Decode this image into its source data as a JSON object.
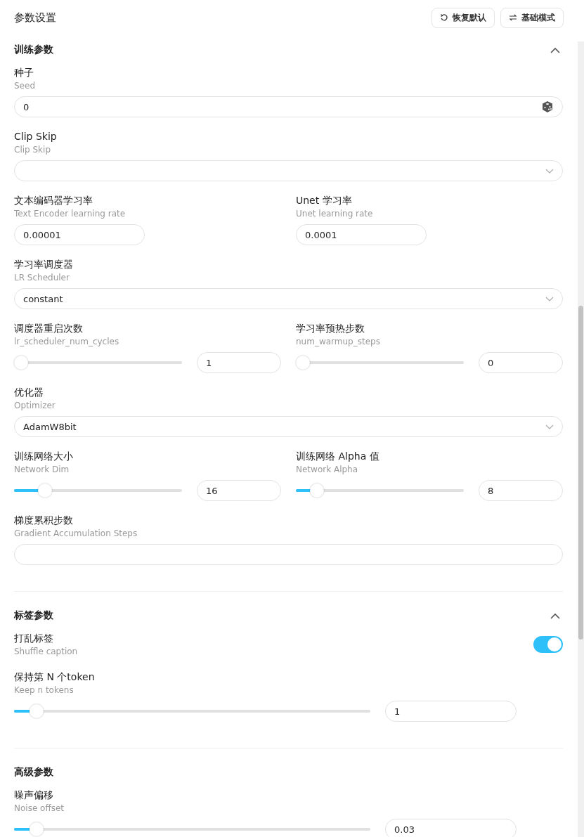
{
  "title": "参数设置",
  "buttons": [
    {
      "label": "恢复默认",
      "kind": "reset"
    },
    {
      "label": "基础模式",
      "kind": "swap"
    }
  ],
  "sections": [
    {
      "title": "训练参数",
      "expanded": true,
      "rows": [
        {
          "fields": [
            {
              "kind": "seed",
              "label": "种子",
              "sublabel": "Seed",
              "value": "0"
            }
          ]
        },
        {
          "fields": [
            {
              "kind": "select",
              "label": "Clip Skip",
              "sublabel": "Clip Skip"
            }
          ]
        },
        {
          "fields": [
            {
              "kind": "number",
              "label": "文本编码器学习率",
              "sublabel": "Text Encoder learning rate",
              "value": "0.00001"
            },
            {
              "kind": "number",
              "label": "Unet 学习率",
              "sublabel": "Unet learning rate",
              "value": "0.0001"
            }
          ]
        },
        {
          "fields": [
            {
              "kind": "select",
              "label": "学习率调度器",
              "sublabel": "LR Scheduler",
              "value": "constant"
            }
          ]
        },
        {
          "fields": [
            {
              "kind": "slider",
              "label": "调度器重启次数",
              "sublabel": "lr_scheduler_num_cycles",
              "value": "1",
              "level": 0
            },
            {
              "kind": "slider",
              "label": "学习率预热步数",
              "sublabel": "num_warmup_steps",
              "value": "0",
              "level": 0
            }
          ]
        },
        {
          "fields": [
            {
              "kind": "select",
              "label": "优化器",
              "sublabel": "Optimizer",
              "value": "AdamW8bit"
            }
          ]
        },
        {
          "fields": [
            {
              "kind": "slider",
              "label": "训练网络大小",
              "sublabel": "Network Dim",
              "value": "16",
              "level": 0.155
            },
            {
              "kind": "slider",
              "label": "训练网络 Alpha 值",
              "sublabel": "Network Alpha",
              "value": "8",
              "level": 0.09
            }
          ]
        },
        {
          "fields": [
            {
              "kind": "text",
              "label": "梯度累积步数",
              "sublabel": "Gradient Accumulation Steps"
            }
          ]
        }
      ]
    },
    {
      "title": "标签参数",
      "expanded": true,
      "rows": [
        {
          "fields": [
            {
              "kind": "switch",
              "label": "打乱标签",
              "sublabel": "Shuffle caption",
              "on": true
            }
          ]
        },
        {
          "fields": [
            {
              "kind": "slider",
              "label": "保持第 N 个token",
              "sublabel": "Keep n tokens",
              "value": "1",
              "level": 0.045
            }
          ]
        }
      ]
    },
    {
      "title": "高级参数",
      "rows": [
        {
          "fields": [
            {
              "kind": "slider",
              "label": "噪声偏移",
              "sublabel": "Noise offset",
              "value": "0.03",
              "level": 0.045
            }
          ]
        }
      ]
    }
  ]
}
